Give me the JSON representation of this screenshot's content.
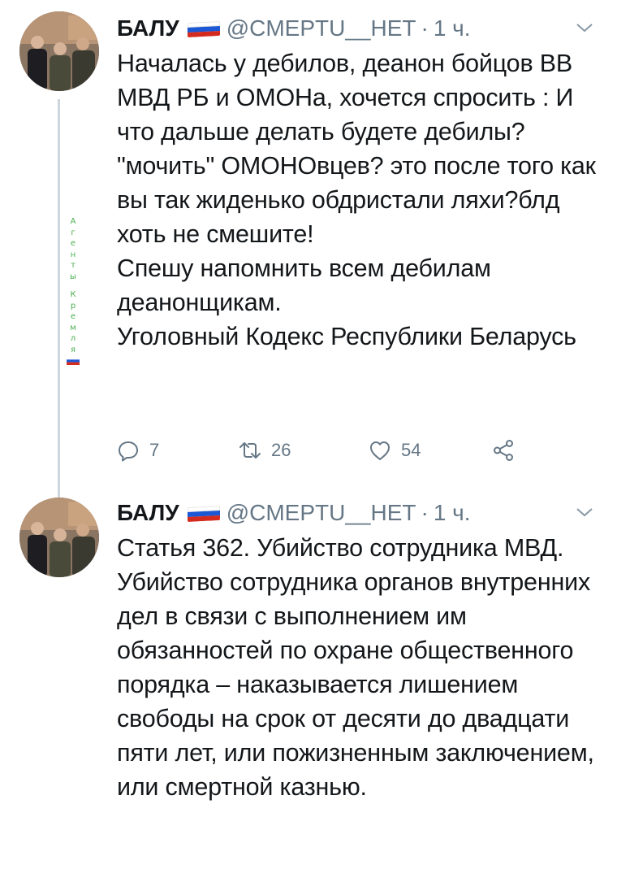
{
  "tweets": [
    {
      "author": "БАЛУ",
      "handle": "@CMEPTU__HET",
      "separator": "·",
      "time": "1 ч.",
      "avatar_icon": "avatar-photo",
      "paragraphs": [
        "Началась у дебилов, деанон бойцов ВВ МВД РБ и ОМОНа, хочется спросить : И что дальше делать будете дебилы? \"мочить\" ОМОНОвцев? это после того как вы так жиденько обдристали ляхи?блд хоть не смешите!",
        "Спешу напомнить всем дебилам деанонщикам.",
        "Уголовный Кодекс Республики Беларусь"
      ],
      "actions": {
        "reply_count": "7",
        "retweet_count": "26",
        "like_count": "54"
      }
    },
    {
      "author": "БАЛУ",
      "handle": "@CMEPTU__HET",
      "separator": "·",
      "time": "1 ч.",
      "avatar_icon": "avatar-photo",
      "paragraphs": [
        "Статья 362. Убийство сотрудника МВД.",
        "Убийство сотрудника органов внутренних дел в связи с выполнением им обязанностей по охране общественного порядка – наказывается лишением свободы на срок от десяти до двадцати пяти лет, или пожизненным заключением, или смертной казнью."
      ]
    }
  ],
  "watermark": {
    "word1": "Агенты",
    "word2": "Кремля",
    "color": "#4caf50"
  },
  "colors": {
    "text": "#14171a",
    "secondary": "#657786",
    "thread_line": "#ccd6dd",
    "flag_white": "#ffffff",
    "flag_blue": "#1c57d4",
    "flag_red": "#d52b1e"
  }
}
